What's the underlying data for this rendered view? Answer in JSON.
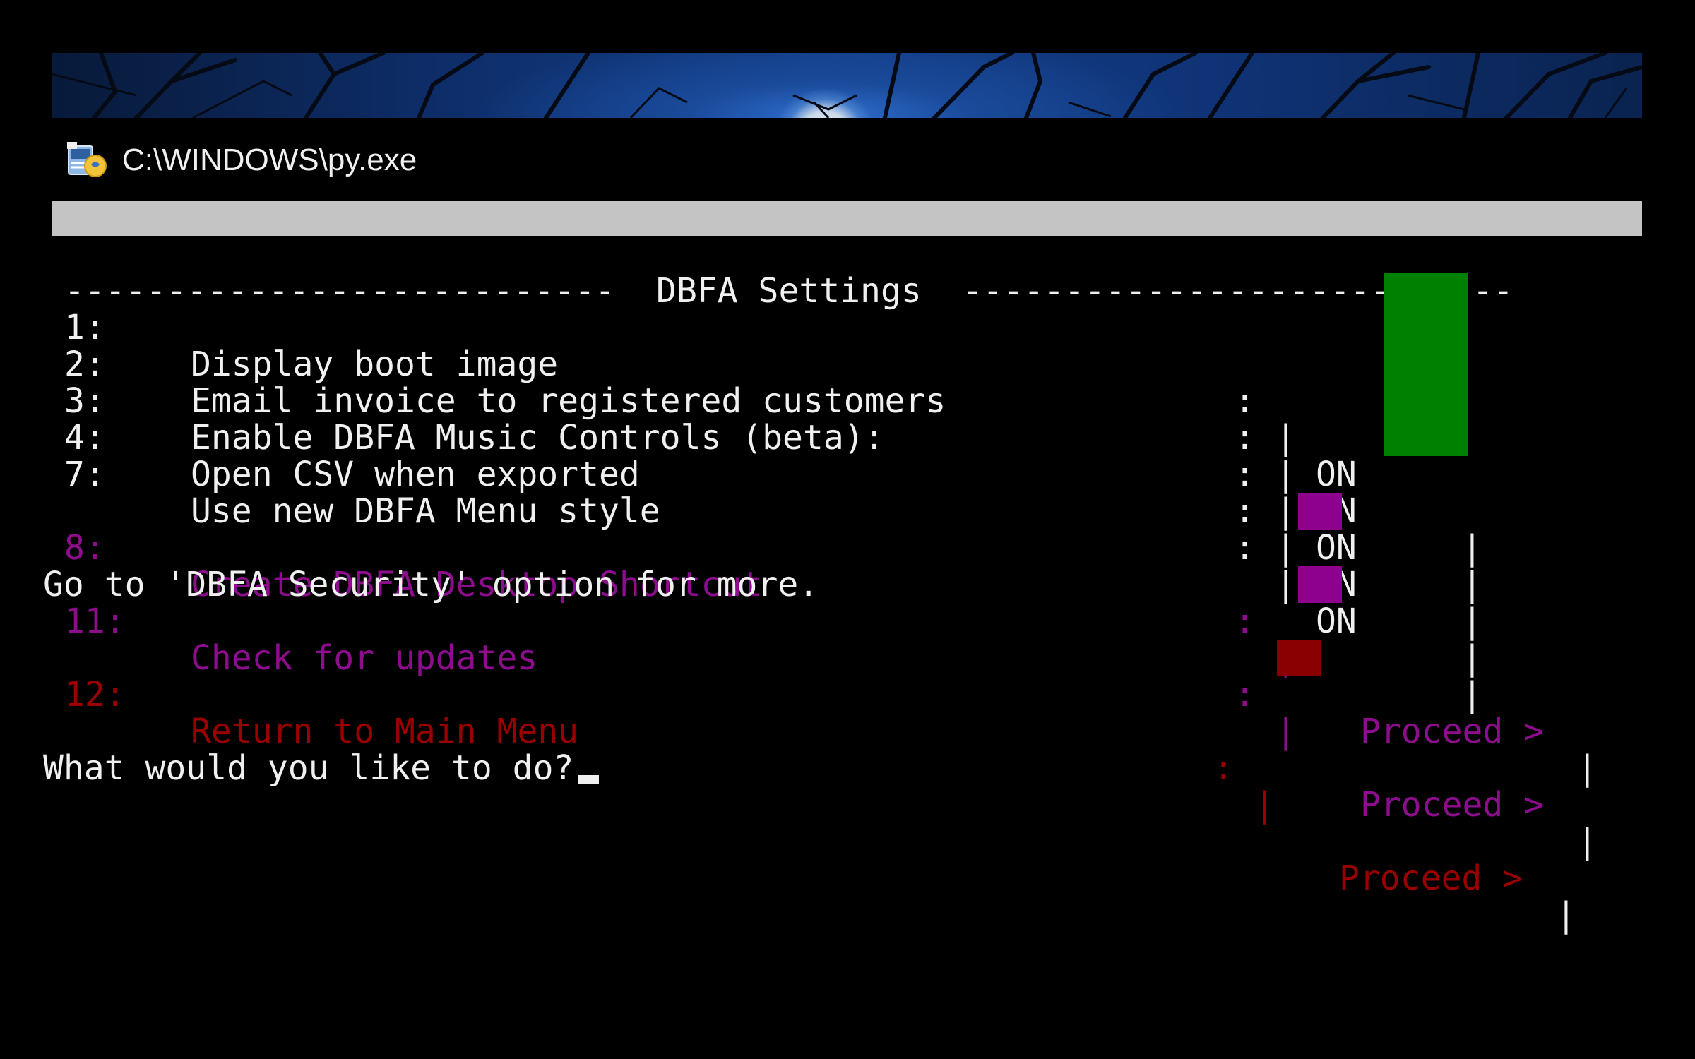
{
  "window": {
    "title": "C:\\WINDOWS\\py.exe"
  },
  "console": {
    "header": "---------------------------  DBFA Settings  ---------------------------",
    "settings": [
      {
        "num": "1:",
        "label": "Display boot image",
        "colon": ":",
        "state": "ON"
      },
      {
        "num": "2:",
        "label": "Email invoice to registered customers",
        "colon": ":",
        "state": "ON"
      },
      {
        "num": "3:",
        "label": "Enable DBFA Music Controls (beta):",
        "colon": ":",
        "state": "ON"
      },
      {
        "num": "4:",
        "label": "Open CSV when exported",
        "colon": ":",
        "state": "ON"
      },
      {
        "num": "7:",
        "label": "Use new DBFA Menu style",
        "colon": ":",
        "state": "ON"
      }
    ],
    "pipe": "|",
    "actions": [
      {
        "num": "8:",
        "label": "Create DBFA Desktop Shortcut",
        "colon": ":",
        "action": "Proceed >",
        "color": "#8e0c8e"
      },
      {
        "num": "11:",
        "label": "Check for updates",
        "colon": ":",
        "action": "Proceed >",
        "color": "#8e0c8e"
      },
      {
        "num": "12:",
        "label": "Return to Main Menu",
        "colon": ":",
        "action": "Proceed >",
        "color": "#9a0000"
      }
    ],
    "security_note": "Go to 'DBFA Security' option for more.",
    "prompt": "What would you like to do?"
  },
  "colors": {
    "on_indicator": "#008000",
    "magenta": "#8e0c8e",
    "darkred": "#9a0000",
    "scrollbar": "#c4c4c4"
  },
  "icons": {
    "app": "python-launcher-icon"
  }
}
